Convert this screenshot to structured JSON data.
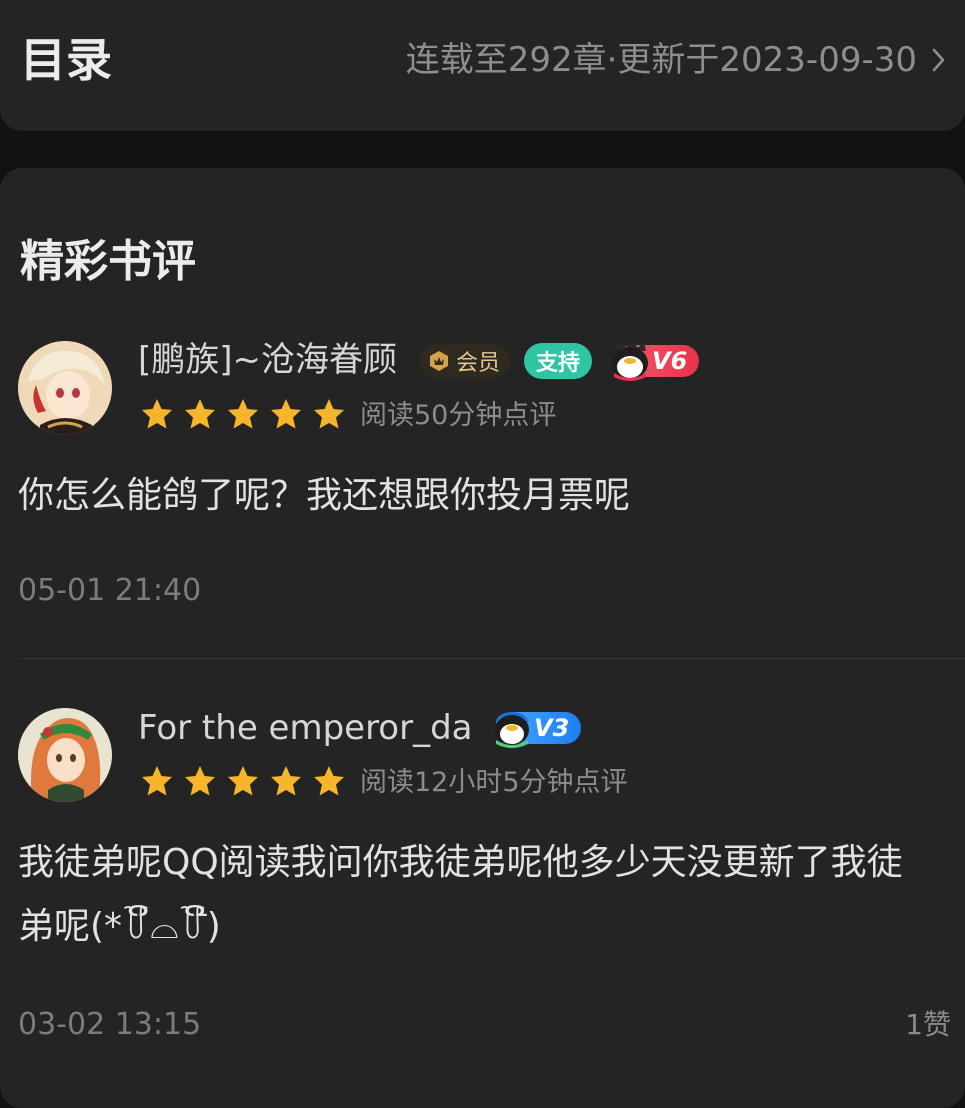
{
  "toc": {
    "title": "目录",
    "status": "连载至292章·更新于2023-09-30"
  },
  "reviews_section": {
    "title": "精彩书评",
    "reviews": [
      {
        "username": "[鹏族]~沧海眷顾",
        "badges": {
          "member": "会员",
          "support": "支持",
          "level": "V6"
        },
        "rating": 5,
        "read_time": "阅读50分钟点评",
        "content": "你怎么能鸽了呢？我还想跟你投月票呢",
        "timestamp": "05-01 21:40"
      },
      {
        "username": "For the emperor_da",
        "badges": {
          "level": "V3"
        },
        "rating": 5,
        "read_time": "阅读12小时5分钟点评",
        "content": "我徒弟呢QQ阅读我问你我徒弟呢他多少天没更新了我徒弟呢(*꒦ິ⌓꒦ີ)",
        "timestamp": "03-02 13:15",
        "likes": "1赞"
      }
    ]
  },
  "colors": {
    "star": "#f7b52c",
    "support_badge": "#2fc5a4",
    "level_v6": "#e8324b",
    "level_v3": "#1e7ef2"
  }
}
